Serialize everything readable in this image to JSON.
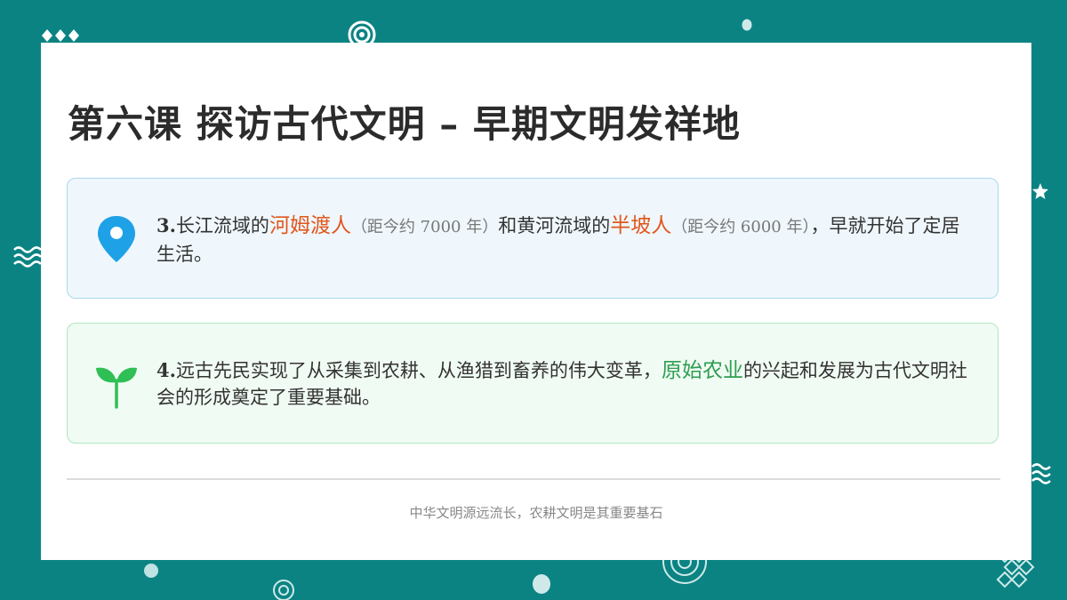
{
  "slide": {
    "title": "第六课 探访古代文明 – 早期文明发祥地",
    "cards": [
      {
        "icon": "map-pin-icon",
        "accent": "#1ea1e6",
        "num": "3.",
        "t1": "长江流域的",
        "h1": "河姆渡人",
        "n1": "（距今约 7000 年）",
        "t2": "和黄河流域的",
        "h2": "半坡人",
        "n2": "（距今约 6000 年）",
        "t3": "，早就开始了定居生活。"
      },
      {
        "icon": "sprout-icon",
        "accent": "#2fbf55",
        "num": "4.",
        "t1": "远古先民实现了从采集到农耕、从渔猎到畜养的伟大变革，",
        "h1": "原始农业",
        "t2": "的兴起和发展为古代文明社会的形成奠定了重要基础。"
      }
    ],
    "footer": "中华文明源远流长，农耕文明是其重要基石"
  },
  "colors": {
    "background": "#0b8383",
    "highlight_red": "#e2561c",
    "highlight_green": "#2e9e50"
  }
}
